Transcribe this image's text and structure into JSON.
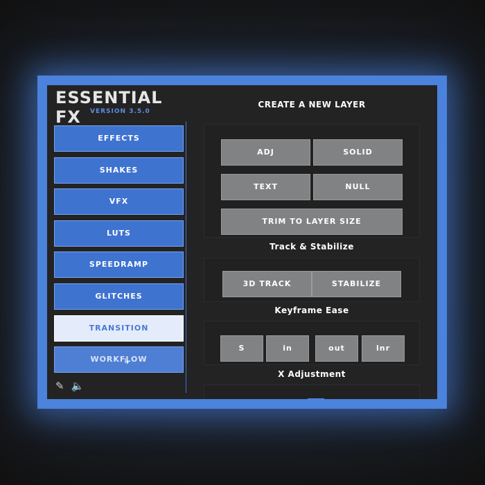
{
  "app": {
    "title": "ESSENTIAL FX",
    "version": "VERSION 3.5.0"
  },
  "sidebar": {
    "items": [
      {
        "label": "EFFECTS"
      },
      {
        "label": "SHAKES"
      },
      {
        "label": "VFX"
      },
      {
        "label": "LUTS"
      },
      {
        "label": "SPEEDRAMP"
      },
      {
        "label": "GLITCHES"
      },
      {
        "label": "TRANSITION"
      },
      {
        "label": "WORKFLOW"
      }
    ],
    "footer": {
      "eyedropper_icon": "eyedropper-icon",
      "volume_icon": "speaker-icon"
    }
  },
  "main": {
    "create_layer": {
      "heading": "CREATE A NEW LAYER",
      "adj": "ADJ",
      "solid": "SOLID",
      "text": "TEXT",
      "null": "NULL",
      "trim": "TRIM TO LAYER SIZE"
    },
    "track": {
      "heading": "Track & Stabilize",
      "track3d": "3D TRACK",
      "stabilize": "STABILIZE"
    },
    "ease": {
      "heading": "Keyframe Ease",
      "s": "S",
      "in": "in",
      "out": "out",
      "lnr": "lnr"
    },
    "xadjust": {
      "heading": "X Adjustment"
    }
  },
  "colors": {
    "accent": "#4a82dc",
    "nav_button": "#3e73d0",
    "nav_active": "#e4ecfb",
    "gray_button": "#808284",
    "panel_bg": "#232323"
  }
}
